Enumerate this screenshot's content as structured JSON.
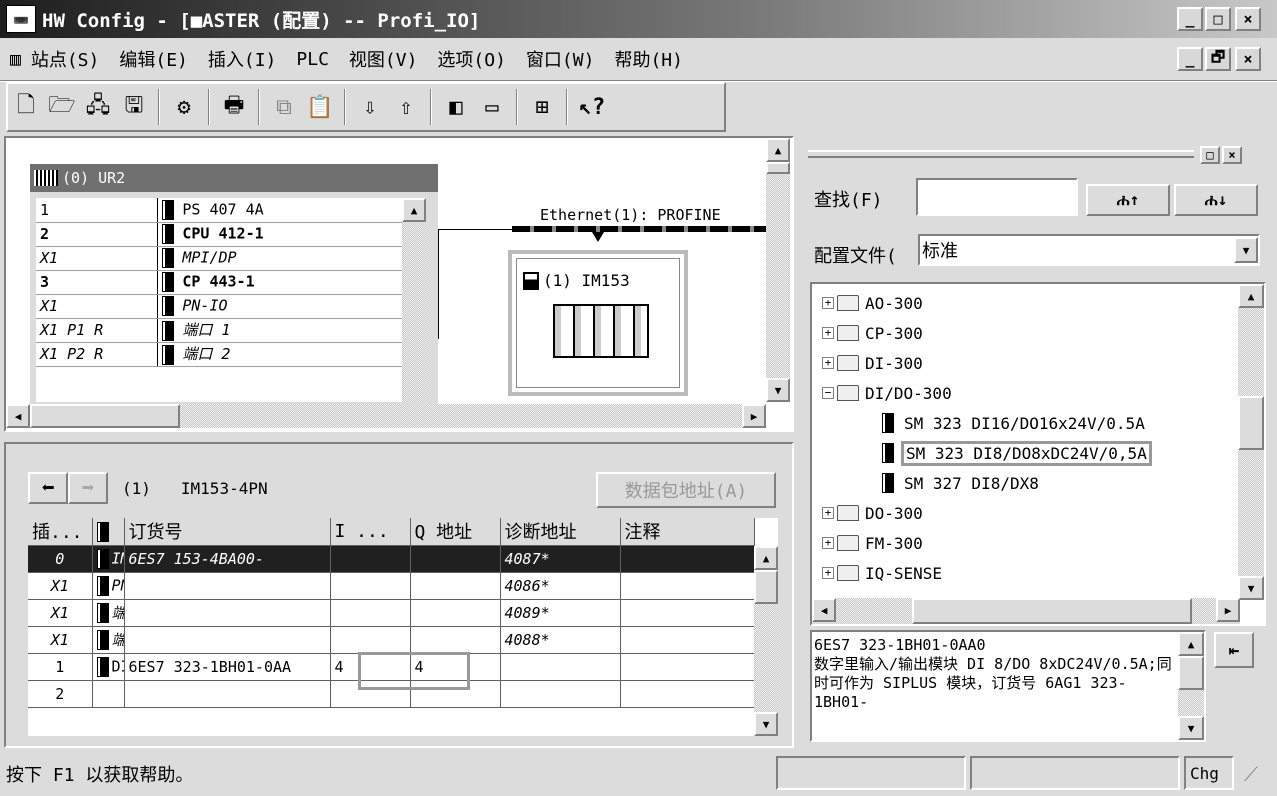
{
  "window": {
    "title": "HW Config - [■ASTER (配置) -- Profi_IO]",
    "minimize": "_",
    "maximize": "□",
    "close": "×",
    "restore": "🗗"
  },
  "menu": [
    "站点(S)",
    "编辑(E)",
    "插入(I)",
    "PLC",
    "视图(V)",
    "选项(O)",
    "窗口(W)",
    "帮助(H)"
  ],
  "rack": {
    "title": "(0) UR2",
    "rows": [
      {
        "slot": "1",
        "module": "PS 407 4A",
        "style": "normal"
      },
      {
        "slot": "2",
        "module": "CPU 412-1",
        "style": "bold"
      },
      {
        "slot": "X1",
        "module": "MPI/DP",
        "style": "italic"
      },
      {
        "slot": "3",
        "module": "CP 443-1",
        "style": "bold"
      },
      {
        "slot": "X1",
        "module": "PN-IO",
        "style": "italic"
      },
      {
        "slot": "X1 P1 R",
        "module": "端口 1",
        "style": "italic"
      },
      {
        "slot": "X1 P2 R",
        "module": "端口 2",
        "style": "italic"
      }
    ]
  },
  "network": {
    "label": "Ethernet(1): PROFINE",
    "device": "(1) IM153"
  },
  "detail": {
    "device_num": "(1)",
    "device_name": "IM153-4PN",
    "address_button": "数据包地址(A)",
    "headers": [
      "插...",
      "",
      "订货号",
      "I ...",
      "Q 地址",
      "诊断地址",
      "注释"
    ],
    "rows": [
      {
        "slot": "0",
        "name": "IM",
        "order": "6ES7 153-4BA00-",
        "i": "",
        "q": "",
        "diag": "4087*",
        "comment": "",
        "sel": true
      },
      {
        "slot": "X1",
        "name": "PN",
        "order": "",
        "i": "",
        "q": "",
        "diag": "4086*",
        "comment": ""
      },
      {
        "slot": "X1",
        "name": "端",
        "order": "",
        "i": "",
        "q": "",
        "diag": "4089*",
        "comment": ""
      },
      {
        "slot": "X1",
        "name": "端",
        "order": "",
        "i": "",
        "q": "",
        "diag": "4088*",
        "comment": ""
      },
      {
        "slot": "1",
        "name": "DI",
        "order": "6ES7 323-1BH01-0AA",
        "i": "4",
        "q": "4",
        "diag": "",
        "comment": ""
      },
      {
        "slot": "2",
        "name": "",
        "order": "",
        "i": "",
        "q": "",
        "diag": "",
        "comment": ""
      }
    ]
  },
  "catalog": {
    "find_label": "查找(F)",
    "find_value": "",
    "profile_label": "配置文件(",
    "profile_value": "标准",
    "tree": [
      {
        "label": "AO-300",
        "level": 0,
        "exp": "+"
      },
      {
        "label": "CP-300",
        "level": 0,
        "exp": "+"
      },
      {
        "label": "DI-300",
        "level": 0,
        "exp": "+"
      },
      {
        "label": "DI/DO-300",
        "level": 0,
        "exp": "-"
      },
      {
        "label": "SM 323 DI16/DO16x24V/0.5A",
        "level": 1
      },
      {
        "label": "SM 323 DI8/DO8xDC24V/0,5A",
        "level": 1,
        "sel": true
      },
      {
        "label": "SM 327 DI8/DX8",
        "level": 1
      },
      {
        "label": "DO-300",
        "level": 0,
        "exp": "+"
      },
      {
        "label": "FM-300",
        "level": 0,
        "exp": "+"
      },
      {
        "label": "IQ-SENSE",
        "level": 0,
        "exp": "+"
      }
    ],
    "info": "6ES7 323-1BH01-0AA0\n数字里输入/输出模块 DI 8/DO 8xDC24V/0.5A;同时可作为 SIPLUS 模块，订货号 6AG1 323-1BH01-"
  },
  "status": {
    "help": "按下 F1 以获取帮助。",
    "chg": "Chg"
  }
}
